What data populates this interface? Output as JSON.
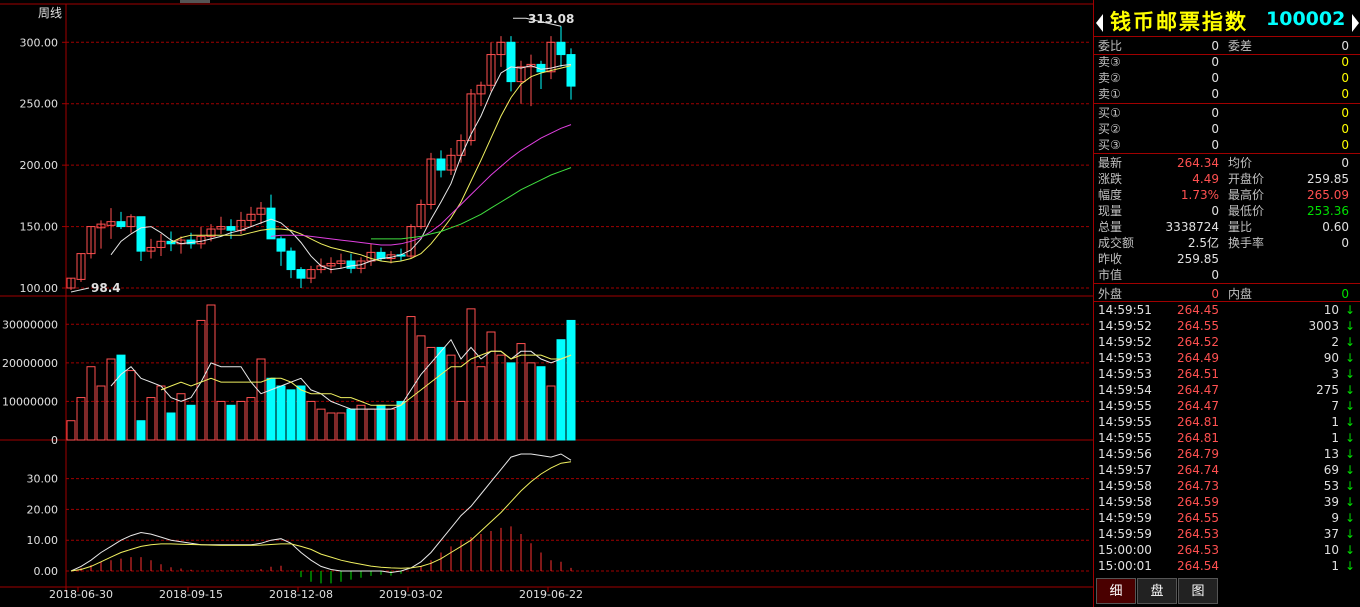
{
  "panel": {
    "name": "钱币邮票指数",
    "code": "100002",
    "quote_rows": [
      {
        "l1": "委比",
        "v1": "0",
        "l2": "委差",
        "v2": "0",
        "c1": "#e0e0e0",
        "c2": "#e0e0e0"
      },
      {
        "l1": "卖③",
        "v1": "0",
        "l2": "",
        "v2": "0",
        "c1": "#e0e0e0",
        "c2": "#ffff00"
      },
      {
        "l1": "卖②",
        "v1": "0",
        "l2": "",
        "v2": "0",
        "c1": "#e0e0e0",
        "c2": "#ffff00"
      },
      {
        "l1": "卖①",
        "v1": "0",
        "l2": "",
        "v2": "0",
        "c1": "#e0e0e0",
        "c2": "#ffff00"
      },
      {
        "l1": "买①",
        "v1": "0",
        "l2": "",
        "v2": "0",
        "c1": "#e0e0e0",
        "c2": "#ffff00"
      },
      {
        "l1": "买②",
        "v1": "0",
        "l2": "",
        "v2": "0",
        "c1": "#e0e0e0",
        "c2": "#ffff00"
      },
      {
        "l1": "买③",
        "v1": "0",
        "l2": "",
        "v2": "0",
        "c1": "#e0e0e0",
        "c2": "#ffff00"
      },
      {
        "l1": "最新",
        "v1": "264.34",
        "l2": "均价",
        "v2": "0",
        "c1": "#ff5050",
        "c2": "#e0e0e0"
      },
      {
        "l1": "涨跌",
        "v1": "4.49",
        "l2": "开盘价",
        "v2": "259.85",
        "c1": "#ff5050",
        "c2": "#e0e0e0"
      },
      {
        "l1": "幅度",
        "v1": "1.73%",
        "l2": "最高价",
        "v2": "265.09",
        "c1": "#ff5050",
        "c2": "#ff5050"
      },
      {
        "l1": "现量",
        "v1": "0",
        "l2": "最低价",
        "v2": "253.36",
        "c1": "#e0e0e0",
        "c2": "#00e000"
      },
      {
        "l1": "总量",
        "v1": "3338724",
        "l2": "量比",
        "v2": "0.60",
        "c1": "#e0e0e0",
        "c2": "#e0e0e0"
      },
      {
        "l1": "成交额",
        "v1": "2.5亿",
        "l2": "换手率",
        "v2": "0",
        "c1": "#e0e0e0",
        "c2": "#e0e0e0"
      },
      {
        "l1": "昨收",
        "v1": "259.85",
        "l2": "",
        "v2": "",
        "c1": "#e0e0e0",
        "c2": "#e0e0e0"
      },
      {
        "l1": "市值",
        "v1": "0",
        "l2": "",
        "v2": "",
        "c1": "#e0e0e0",
        "c2": "#e0e0e0"
      },
      {
        "l1": "外盘",
        "v1": "0",
        "l2": "内盘",
        "v2": "0",
        "c1": "#ff5050",
        "c2": "#00e000"
      }
    ],
    "ticks": [
      {
        "t": "14:59:51",
        "p": "264.45",
        "v": "10"
      },
      {
        "t": "14:59:52",
        "p": "264.55",
        "v": "3003"
      },
      {
        "t": "14:59:52",
        "p": "264.52",
        "v": "2"
      },
      {
        "t": "14:59:53",
        "p": "264.49",
        "v": "90"
      },
      {
        "t": "14:59:53",
        "p": "264.51",
        "v": "3"
      },
      {
        "t": "14:59:54",
        "p": "264.47",
        "v": "275"
      },
      {
        "t": "14:59:55",
        "p": "264.47",
        "v": "7"
      },
      {
        "t": "14:59:55",
        "p": "264.81",
        "v": "1"
      },
      {
        "t": "14:59:55",
        "p": "264.81",
        "v": "1"
      },
      {
        "t": "14:59:56",
        "p": "264.79",
        "v": "13"
      },
      {
        "t": "14:59:57",
        "p": "264.74",
        "v": "69"
      },
      {
        "t": "14:59:58",
        "p": "264.73",
        "v": "53"
      },
      {
        "t": "14:59:58",
        "p": "264.59",
        "v": "39"
      },
      {
        "t": "14:59:59",
        "p": "264.55",
        "v": "9"
      },
      {
        "t": "14:59:59",
        "p": "264.53",
        "v": "37"
      },
      {
        "t": "15:00:00",
        "p": "264.53",
        "v": "10"
      },
      {
        "t": "15:00:01",
        "p": "264.54",
        "v": "1"
      }
    ],
    "tabs": [
      "细",
      "盘",
      "图"
    ],
    "colors": {
      "label": "#c0c0c0",
      "up": "#ff5050",
      "down": "#00e000",
      "flat": "#e0e0e0",
      "border": "#a00000"
    }
  },
  "chart_data": {
    "type": "candlestick",
    "period_label": "周线",
    "x_labels": [
      "2018-06-30",
      "2018-09-15",
      "2018-12-08",
      "2019-03-02",
      "2019-06-22"
    ],
    "x_label_index": [
      1,
      12,
      23,
      34,
      48
    ],
    "price": {
      "ylim": [
        100,
        310
      ],
      "ticks": [
        "100.00",
        "150.00",
        "200.00",
        "250.00",
        "300.00"
      ],
      "max_label": "313.08",
      "min_label": "98.4",
      "candles": [
        [
          100,
          108,
          98.4,
          108
        ],
        [
          107,
          128,
          105,
          128
        ],
        [
          128,
          150,
          124,
          150
        ],
        [
          149,
          155,
          132,
          152
        ],
        [
          151,
          165,
          140,
          154
        ],
        [
          154,
          162,
          148,
          150
        ],
        [
          150,
          160,
          145,
          158
        ],
        [
          158,
          155,
          122,
          130
        ],
        [
          130,
          140,
          124,
          133
        ],
        [
          133,
          144,
          126,
          138
        ],
        [
          138,
          146,
          130,
          136
        ],
        [
          136,
          142,
          128,
          139
        ],
        [
          139,
          145,
          132,
          136
        ],
        [
          136,
          150,
          132,
          142
        ],
        [
          142,
          152,
          138,
          148
        ],
        [
          148,
          158,
          144,
          150
        ],
        [
          150,
          156,
          140,
          147
        ],
        [
          147,
          162,
          144,
          155
        ],
        [
          155,
          166,
          150,
          160
        ],
        [
          160,
          170,
          152,
          165
        ],
        [
          165,
          176,
          160,
          140
        ],
        [
          140,
          142,
          118,
          130
        ],
        [
          130,
          133,
          108,
          115
        ],
        [
          115,
          117,
          100,
          108
        ],
        [
          108,
          118,
          104,
          115
        ],
        [
          115,
          124,
          112,
          118
        ],
        [
          118,
          125,
          112,
          120
        ],
        [
          120,
          128,
          116,
          122
        ],
        [
          122,
          128,
          112,
          116
        ],
        [
          116,
          125,
          112,
          122
        ],
        [
          122,
          136,
          118,
          129
        ],
        [
          129,
          133,
          122,
          124
        ],
        [
          124,
          130,
          120,
          127
        ],
        [
          127,
          132,
          122,
          126
        ],
        [
          126,
          152,
          124,
          150
        ],
        [
          150,
          172,
          148,
          168
        ],
        [
          168,
          210,
          164,
          205
        ],
        [
          205,
          212,
          190,
          196
        ],
        [
          196,
          214,
          192,
          208
        ],
        [
          208,
          225,
          202,
          220
        ],
        [
          220,
          262,
          216,
          258
        ],
        [
          258,
          268,
          248,
          265
        ],
        [
          265,
          300,
          260,
          290
        ],
        [
          290,
          305,
          280,
          300
        ],
        [
          300,
          305,
          260,
          268
        ],
        [
          268,
          285,
          250,
          280
        ],
        [
          280,
          290,
          248,
          282
        ],
        [
          282,
          285,
          262,
          276
        ],
        [
          276,
          305,
          270,
          300
        ],
        [
          300,
          313.08,
          280,
          290
        ],
        [
          290,
          295,
          253.36,
          264.34
        ]
      ],
      "ma_series": [
        {
          "color": "#e8e8e8",
          "values": [
            null,
            null,
            null,
            null,
            127,
            138,
            144,
            149,
            150,
            145,
            139,
            136,
            137,
            138,
            140,
            142,
            145,
            147,
            150,
            153,
            156,
            153,
            146,
            137,
            126,
            118,
            115,
            116,
            118,
            119,
            122,
            124,
            125,
            127,
            131,
            140,
            156,
            170,
            185,
            207,
            225,
            240,
            259,
            275,
            280,
            279,
            281,
            278,
            279,
            281,
            282
          ]
        },
        {
          "color": "#f0f060",
          "values": [
            null,
            null,
            null,
            null,
            null,
            null,
            null,
            null,
            null,
            null,
            137,
            141,
            143,
            143,
            143,
            143,
            143,
            143,
            145,
            147,
            148,
            148,
            147,
            144,
            140,
            136,
            133,
            131,
            129,
            127,
            124,
            122,
            121,
            122,
            124,
            128,
            136,
            146,
            157,
            170,
            187,
            204,
            222,
            240,
            255,
            266,
            272,
            275,
            277,
            279,
            281
          ]
        },
        {
          "color": "#e040e0",
          "values": [
            null,
            null,
            null,
            null,
            null,
            null,
            null,
            null,
            null,
            null,
            null,
            null,
            null,
            null,
            null,
            null,
            null,
            null,
            null,
            null,
            142,
            143,
            143,
            143,
            142,
            141,
            140,
            139,
            138,
            137,
            136,
            135,
            135,
            136,
            138,
            141,
            146,
            152,
            160,
            168,
            176,
            184,
            192,
            199,
            206,
            212,
            217,
            222,
            226,
            230,
            233
          ]
        },
        {
          "color": "#40e040",
          "values": [
            null,
            null,
            null,
            null,
            null,
            null,
            null,
            null,
            null,
            null,
            null,
            null,
            null,
            null,
            null,
            null,
            null,
            null,
            null,
            null,
            null,
            null,
            null,
            null,
            null,
            null,
            null,
            null,
            null,
            null,
            140,
            140,
            140,
            140,
            141,
            142,
            144,
            146,
            149,
            152,
            156,
            160,
            165,
            170,
            175,
            180,
            184,
            188,
            192,
            195,
            198
          ]
        }
      ]
    },
    "volume": {
      "ylim": [
        0,
        35000000
      ],
      "ticks": [
        "0",
        "10000000",
        "20000000",
        "30000000"
      ],
      "values": [
        5000000,
        11000000,
        19000000,
        14000000,
        21000000,
        22000000,
        18000000,
        5000000,
        11000000,
        14000000,
        7000000,
        12000000,
        9000000,
        31000000,
        35000000,
        10000000,
        9000000,
        10000000,
        11000000,
        21000000,
        16000000,
        14000000,
        13000000,
        14000000,
        10000000,
        8000000,
        7000000,
        7000000,
        8000000,
        9000000,
        8000000,
        9000000,
        8000000,
        10000000,
        32000000,
        27000000,
        24000000,
        24000000,
        22000000,
        10000000,
        34000000,
        19000000,
        28000000,
        22000000,
        20000000,
        25000000,
        20000000,
        19000000,
        14000000,
        26000000,
        31000000
      ],
      "ma_series": [
        {
          "color": "#e8e8e8",
          "values": [
            null,
            null,
            null,
            null,
            14000000,
            17000000,
            19000000,
            16000000,
            15000000,
            14000000,
            11000000,
            10000000,
            11000000,
            15000000,
            20000000,
            19000000,
            19000000,
            19000000,
            15000000,
            12000000,
            13000000,
            14000000,
            15000000,
            16000000,
            13000000,
            12000000,
            10000000,
            9000000,
            8000000,
            8000000,
            8000000,
            8000000,
            8000000,
            9000000,
            13000000,
            17000000,
            20000000,
            23000000,
            26000000,
            21000000,
            24000000,
            21000000,
            23000000,
            23000000,
            21000000,
            23000000,
            23000000,
            21000000,
            20000000,
            21000000,
            22000000
          ]
        },
        {
          "color": "#f0f060",
          "values": [
            null,
            null,
            null,
            null,
            null,
            null,
            null,
            null,
            null,
            13000000,
            14000000,
            15000000,
            14000000,
            15000000,
            16000000,
            15000000,
            15000000,
            15000000,
            15000000,
            15000000,
            16000000,
            16000000,
            15000000,
            13000000,
            12000000,
            12000000,
            12000000,
            11000000,
            11000000,
            10000000,
            9000000,
            9000000,
            9000000,
            9000000,
            11000000,
            13000000,
            15000000,
            17000000,
            19000000,
            19000000,
            21000000,
            22000000,
            23000000,
            23000000,
            21000000,
            22000000,
            22000000,
            22000000,
            21000000,
            21000000,
            22000000
          ]
        }
      ]
    },
    "macd": {
      "ylim": [
        -3,
        38
      ],
      "ticks": [
        "0.00",
        "10.00",
        "20.00",
        "30.00"
      ],
      "dif": [
        0,
        1.5,
        3.5,
        6,
        8,
        10,
        11.5,
        12.5,
        12,
        11,
        10,
        9.5,
        9,
        8.5,
        8.5,
        8.5,
        8.5,
        8.5,
        8.5,
        9,
        10,
        10.5,
        9,
        6,
        3.5,
        1.5,
        0.5,
        0,
        0,
        0,
        0,
        0,
        -0.5,
        0,
        1,
        3,
        6,
        10,
        14,
        18,
        21,
        25,
        29,
        33,
        37,
        38,
        38,
        37.5,
        37,
        38,
        36
      ],
      "dea": [
        0,
        0.5,
        1.5,
        3,
        4.5,
        6,
        7,
        8,
        8.5,
        8.8,
        8.8,
        8.7,
        8.6,
        8.5,
        8.4,
        8.3,
        8.3,
        8.3,
        8.3,
        8.4,
        8.6,
        8.8,
        8.8,
        8,
        7,
        5.5,
        4.5,
        3.5,
        2.8,
        2.2,
        1.6,
        1.2,
        1,
        0.9,
        1,
        1.5,
        2.5,
        4,
        6,
        8,
        10,
        13,
        16,
        19,
        22.5,
        26,
        29,
        31.5,
        33.5,
        35,
        35.5
      ],
      "hist": [
        0,
        1,
        2,
        3,
        3.5,
        4,
        4.5,
        4.5,
        3.5,
        2.2,
        1.2,
        0.8,
        0.4,
        0,
        0.1,
        0.2,
        0.2,
        0.2,
        0.2,
        0.6,
        1.4,
        1.7,
        0.2,
        -2,
        -3.5,
        -4,
        -4,
        -3.5,
        -2.8,
        -2.2,
        -1.6,
        -1.2,
        -1.5,
        -0.9,
        0,
        1.5,
        3.5,
        6,
        8,
        10,
        11,
        12,
        13,
        14,
        14.5,
        12,
        9,
        6,
        3.5,
        3,
        1
      ],
      "dif_color": "#e8e8e8",
      "dea_color": "#f0f060"
    },
    "colors": {
      "up": "#ff5050",
      "down": "#00ffff",
      "grid": "#a00000",
      "axis": "#a00000",
      "label": "#e0e0e0",
      "macd_up": "#ff3030",
      "macd_down": "#00e000"
    }
  }
}
